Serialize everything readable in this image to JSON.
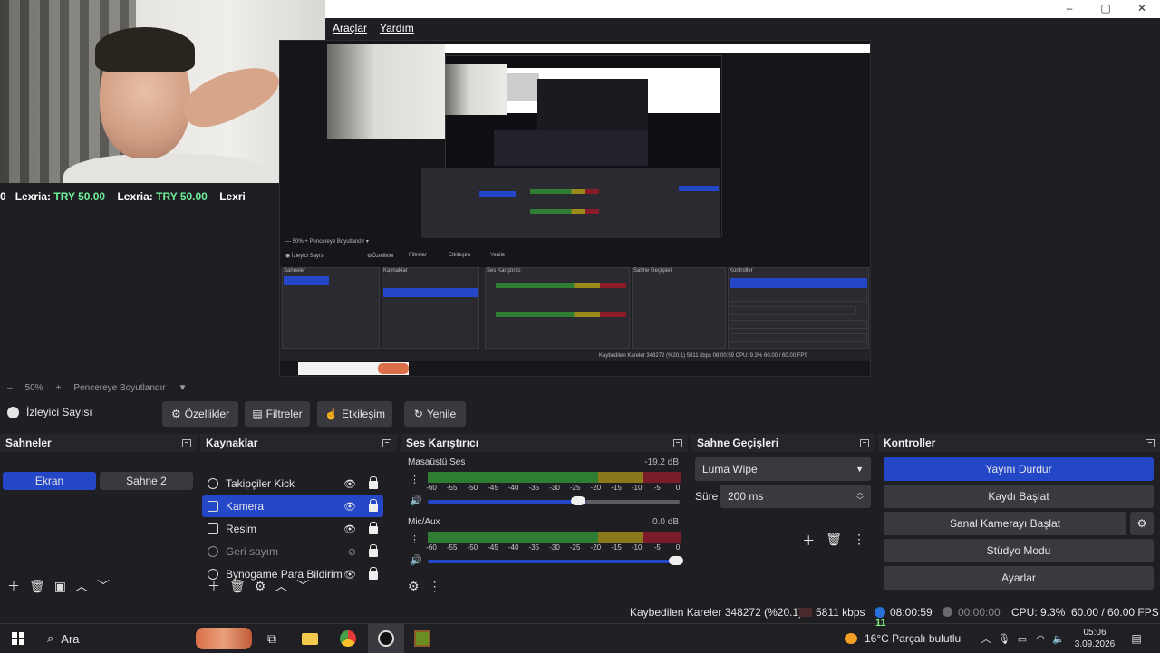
{
  "window": {
    "minimize": "–",
    "maximize": "▢",
    "close": "✕"
  },
  "menu": {
    "items": [
      "Araçlar",
      "Yardım"
    ]
  },
  "ticker": {
    "prefix": "0",
    "name": "Lexria:",
    "amount": "TRY 50.00",
    "tail": "Lexri"
  },
  "zoom": {
    "minus": "–",
    "value": "50%",
    "plus": "+",
    "label": "Pencereye Boyutlandır",
    "arrow": "▼"
  },
  "toolbar": {
    "viewer_label": "İzleyici Sayısı",
    "properties": "Özellikler",
    "filters": "Filtreler",
    "interact": "Etkileşim",
    "refresh": "Yenile"
  },
  "scenes": {
    "title": "Sahneler",
    "items": [
      "Ekran",
      "Sahne 2"
    ],
    "active": "Ekran"
  },
  "sources": {
    "title": "Kaynaklar",
    "items": [
      "Takipçiler Kick",
      "Kamera",
      "Resim",
      "Geri sayım",
      "Bynogame Para Bildirim"
    ],
    "selected": "Kamera",
    "hidden": "Geri sayım"
  },
  "mixer": {
    "title": "Ses Karıştırıcı",
    "channels": [
      {
        "name": "Masaüstü Ses",
        "db": "-19.2 dB",
        "level": 0.62
      },
      {
        "name": "Mic/Aux",
        "db": "0.0 dB",
        "level": 1.0
      }
    ],
    "ticks": [
      "-60",
      "-55",
      "-50",
      "-45",
      "-40",
      "-35",
      "-30",
      "-25",
      "-20",
      "-15",
      "-10",
      "-5",
      "0"
    ]
  },
  "transitions": {
    "title": "Sahne Geçişleri",
    "type": "Luma Wipe",
    "duration_label": "Süre",
    "duration": "200 ms"
  },
  "controls": {
    "title": "Kontroller",
    "stop_stream": "Yayını Durdur",
    "start_record": "Kaydı Başlat",
    "virtual_cam": "Sanal Kamerayı Başlat",
    "studio_mode": "Stüdyo Modu",
    "settings": "Ayarlar"
  },
  "status": {
    "dropped": "Kaybedilen Kareler 348272 (%20.1)",
    "bitrate": "5811 kbps",
    "stream_time": "08:00:59",
    "rec_time": "00:00:00",
    "cpu": "CPU: 9.3%",
    "fps": "60.00 / 60.00 FPS"
  },
  "taskbar": {
    "search": "Ara",
    "weather": "16°C Parçalı bulutlu",
    "time": "05:06",
    "date": "3.09.2026",
    "badge": "11"
  },
  "colors": {
    "accent": "#2447c8",
    "bg": "#1f1e23",
    "panel": "#2b2a30",
    "green": "#2e7d32"
  }
}
